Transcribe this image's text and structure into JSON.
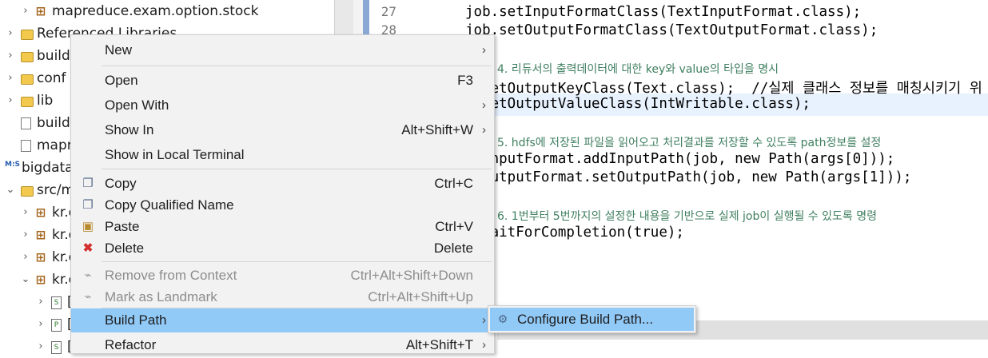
{
  "explorer": {
    "rows": [
      {
        "label": "mapreduce.exam.option.stock",
        "twisty": "›",
        "icon": "package-icon"
      },
      {
        "label": "Referenced Libraries",
        "twisty": "›",
        "icon": "library-icon"
      },
      {
        "label": "build",
        "twisty": "›",
        "icon": "folder-icon"
      },
      {
        "label": "conf",
        "twisty": "›",
        "icon": "folder-icon"
      },
      {
        "label": "lib",
        "twisty": "›",
        "icon": "folder-icon"
      },
      {
        "label": "build",
        "twisty": "",
        "icon": "ant-file-icon"
      },
      {
        "label": "mapre",
        "twisty": "",
        "icon": "file-icon"
      },
      {
        "label": "bigdata",
        "twisty": "",
        "icon": "project-icon"
      },
      {
        "label": "src/m",
        "twisty": "⌄",
        "icon": "source-folder-icon"
      },
      {
        "label": "kr.e",
        "twisty": "›",
        "icon": "package-icon"
      },
      {
        "label": "kr.e",
        "twisty": "›",
        "icon": "package-icon"
      },
      {
        "label": "kr.e",
        "twisty": "›",
        "icon": "package-icon"
      },
      {
        "label": "kr.e",
        "twisty": "⌄",
        "icon": "package-icon"
      },
      {
        "label": "[",
        "twisty": "›",
        "icon": "java-class-icon"
      },
      {
        "label": "[",
        "twisty": "›",
        "icon": "java-class-icon"
      },
      {
        "label": "[",
        "twisty": "›",
        "icon": "java-class-icon"
      }
    ]
  },
  "editor": {
    "line_numbers": [
      "27",
      "28"
    ],
    "lines": {
      "l1": "job.setInputFormatClass(TextInputFormat.class);",
      "l2": "job.setOutputFormatClass(TextOutputFormat.class);",
      "c4": "4. 리듀서의 출력데이터에 대한 key와 value의 타입을 명시",
      "l4": ").setOutputKeyClass(Text.class);  //실제 클래스 정보를 매칭시키기 위",
      "l5": ").setOutputValueClass(IntWritable.class);",
      "c5": "5. hdfs에 저장된 파일을 읽어오고 처리결과를 저장할 수 있도록 path정보를 설정",
      "l6": "leInputFormat.addInputPath(job, new Path(args[0]));",
      "l7": "leOutputFormat.setOutputPath(job, new Path(args[1]));",
      "c6": "6. 1번부터 5번까지의 설정한 내용을 기반으로 실제 job이 실행될 수 있도록 명령",
      "l8": ").waitForCompletion(true);"
    }
  },
  "context_menu": {
    "new": {
      "label": "New",
      "shortcut": ""
    },
    "open": {
      "label": "Open",
      "shortcut": "F3"
    },
    "open_with": {
      "label": "Open With",
      "shortcut": ""
    },
    "show_in": {
      "label": "Show In",
      "shortcut": "Alt+Shift+W"
    },
    "show_terminal": {
      "label": "Show in Local Terminal",
      "shortcut": ""
    },
    "copy": {
      "label": "Copy",
      "shortcut": "Ctrl+C"
    },
    "copy_qualified": {
      "label": "Copy Qualified Name",
      "shortcut": ""
    },
    "paste": {
      "label": "Paste",
      "shortcut": "Ctrl+V"
    },
    "delete": {
      "label": "Delete",
      "shortcut": "Delete"
    },
    "remove_context": {
      "label": "Remove from Context",
      "shortcut": "Ctrl+Alt+Shift+Down"
    },
    "mark_landmark": {
      "label": "Mark as Landmark",
      "shortcut": "Ctrl+Alt+Shift+Up"
    },
    "build_path": {
      "label": "Build Path",
      "shortcut": ""
    },
    "refactor": {
      "label": "Refactor",
      "shortcut": "Alt+Shift+T"
    },
    "arrow": "›"
  },
  "submenu": {
    "configure": {
      "label": "Configure Build Path..."
    }
  },
  "colors": {
    "highlight": "#91c9f7",
    "keyword": "#7f0055",
    "comment": "#3f7f5f"
  }
}
